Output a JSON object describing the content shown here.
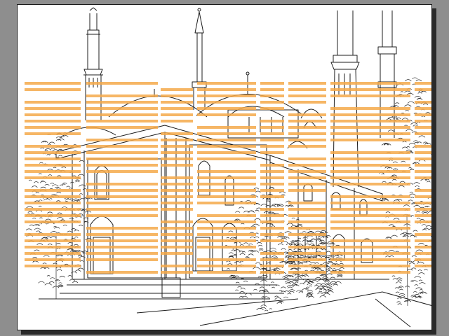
{
  "document": {
    "canvas_color": "#ffffff",
    "workspace_color": "#8e8e8e",
    "line_color": "#1c1c1c",
    "overlay_color": "#f5a94a"
  },
  "artwork": {
    "subject": "mosque-line-drawing",
    "overlay": "horizontal-stripe-text-overlay"
  }
}
